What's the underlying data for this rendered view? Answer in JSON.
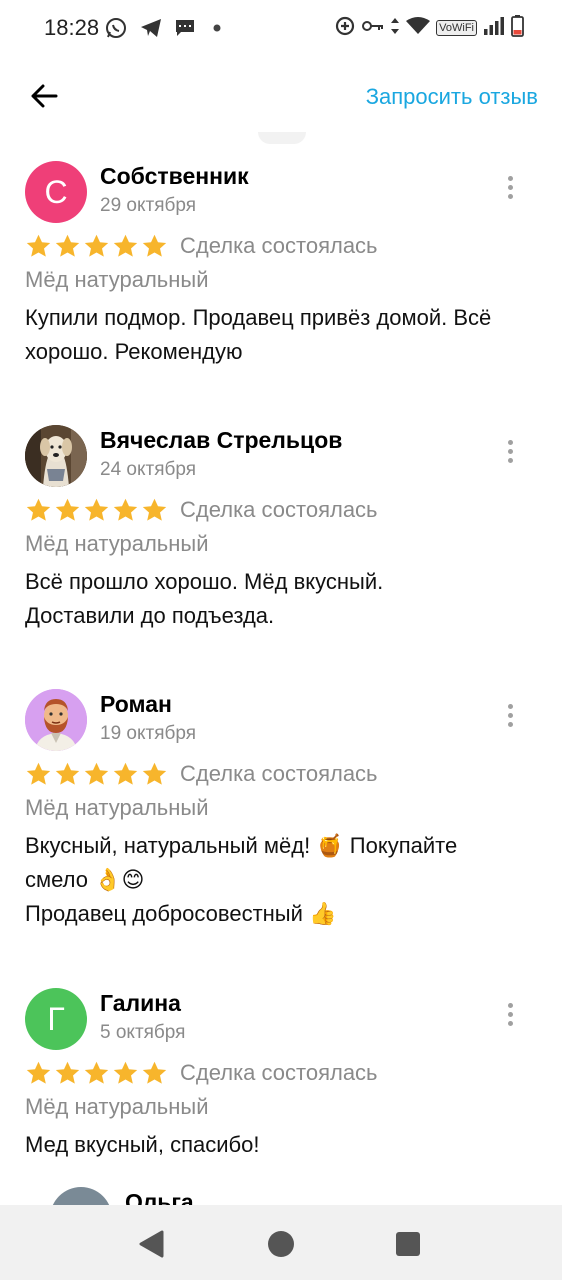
{
  "status_bar": {
    "time": "18:28",
    "left_icons": [
      "whatsapp-icon",
      "telegram-icon",
      "message-icon",
      "dot-icon"
    ],
    "right_icons": [
      "data-saver-icon",
      "key-icon",
      "data-arrows-icon",
      "wifi-icon",
      "vowifi-badge",
      "signal-icon",
      "battery-icon"
    ],
    "vowifi": "VoWiFi"
  },
  "header": {
    "back_icon": "arrow-left-icon",
    "request_label": "Запросить отзыв",
    "accent": "#1aa7e0"
  },
  "reviews": [
    {
      "avatar_letter": "С",
      "avatar_color": "#ef3f78",
      "name": "Собственник",
      "date": "29 октября",
      "stars": 5,
      "deal": "Сделка состоялась",
      "product": "Мёд натуральный",
      "lines": [
        "Купили подмор. Продавец привёз домой. Всё",
        "хорошо.  Рекомендую"
      ]
    },
    {
      "avatar_letter": "",
      "avatar_image": "dog-photo",
      "name": "Вячеслав Стрельцов",
      "date": "24 октября",
      "stars": 5,
      "deal": "Сделка состоялась",
      "product": "Мёд натуральный",
      "lines": [
        "Всё прошло хорошо. Мёд вкусный.",
        "Доставили до подъезда."
      ]
    },
    {
      "avatar_letter": "",
      "avatar_image": "bearded-man-illustration",
      "avatar_color": "#d7a0f0",
      "name": "Роман",
      "date": "19 октября",
      "stars": 5,
      "deal": "Сделка состоялась",
      "product": "Мёд натуральный",
      "lines": [
        "Вкусный, натуральный мёд! 🍯 Покупайте",
        "смело 👌😊",
        "Продавец добросовестный 👍"
      ]
    },
    {
      "avatar_letter": "Г",
      "avatar_color": "#4cc45a",
      "name": "Галина",
      "date": "5 октября",
      "stars": 5,
      "deal": "Сделка состоялась",
      "product": "Мёд натуральный",
      "lines": [
        "Мед вкусный, спасибо!"
      ]
    },
    {
      "avatar_letter": "",
      "avatar_color": "#7a8a96",
      "name": "Ольга"
    }
  ],
  "colors": {
    "star": "#f7b52c",
    "secondary_text": "#8a8a8a"
  },
  "nav_bar": {
    "icons": [
      "nav-back-icon",
      "nav-home-icon",
      "nav-recent-icon"
    ]
  }
}
